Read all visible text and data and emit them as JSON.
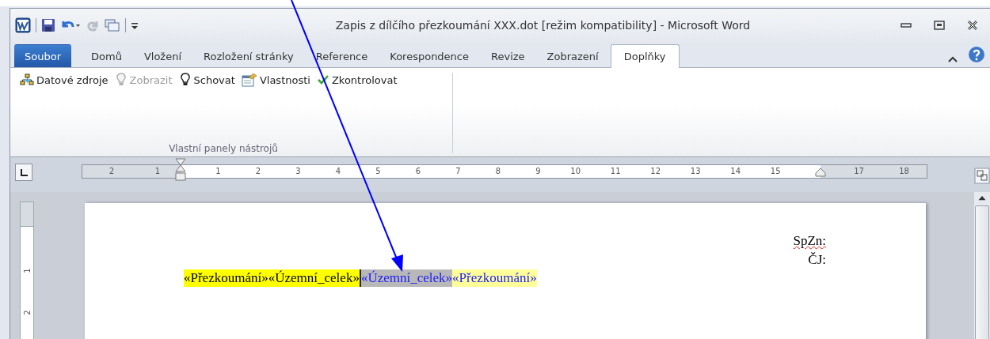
{
  "window": {
    "title": "Zapis z dílčího přezkoumání XXX.dot [režim kompatibility]  -  Microsoft Word"
  },
  "tabs": [
    {
      "label": "Soubor",
      "kind": "file",
      "selected": false
    },
    {
      "label": "Domů",
      "kind": "tab",
      "selected": false
    },
    {
      "label": "Vložení",
      "kind": "tab",
      "selected": false
    },
    {
      "label": "Rozložení stránky",
      "kind": "tab",
      "selected": false
    },
    {
      "label": "Reference",
      "kind": "tab",
      "selected": false
    },
    {
      "label": "Korespondence",
      "kind": "tab",
      "selected": false
    },
    {
      "label": "Revize",
      "kind": "tab",
      "selected": false
    },
    {
      "label": "Zobrazení",
      "kind": "tab",
      "selected": false
    },
    {
      "label": "Doplňky",
      "kind": "tab",
      "selected": true
    }
  ],
  "ribbon": {
    "group_label": "Vlastní panely nástrojů",
    "buttons": [
      {
        "label": "Datové zdroje",
        "disabled": false
      },
      {
        "label": "Zobrazit",
        "disabled": true
      },
      {
        "label": "Schovat",
        "disabled": false
      },
      {
        "label": "Vlastnosti",
        "disabled": false
      },
      {
        "label": "Zkontrolovat",
        "disabled": false
      }
    ]
  },
  "ruler": {
    "left_labels": [
      "2",
      "1"
    ],
    "labels": [
      "1",
      "2",
      "3",
      "4",
      "5",
      "6",
      "7",
      "8",
      "9",
      "10",
      "11",
      "12",
      "13",
      "14",
      "15"
    ],
    "right_labels": [
      "17",
      "18"
    ]
  },
  "vertical_ruler": {
    "labels": [
      "1",
      "2"
    ]
  },
  "document": {
    "header_lines": [
      "SpZn:",
      "ČJ:"
    ],
    "fields": [
      {
        "text": "«Přezkoumání»",
        "kind": "merged"
      },
      {
        "text": "«Územní_celek»",
        "kind": "merged"
      },
      {
        "text": "«Územní_celek»",
        "kind": "selected"
      },
      {
        "text": "«Přezkoumání»",
        "kind": "preview"
      }
    ]
  }
}
